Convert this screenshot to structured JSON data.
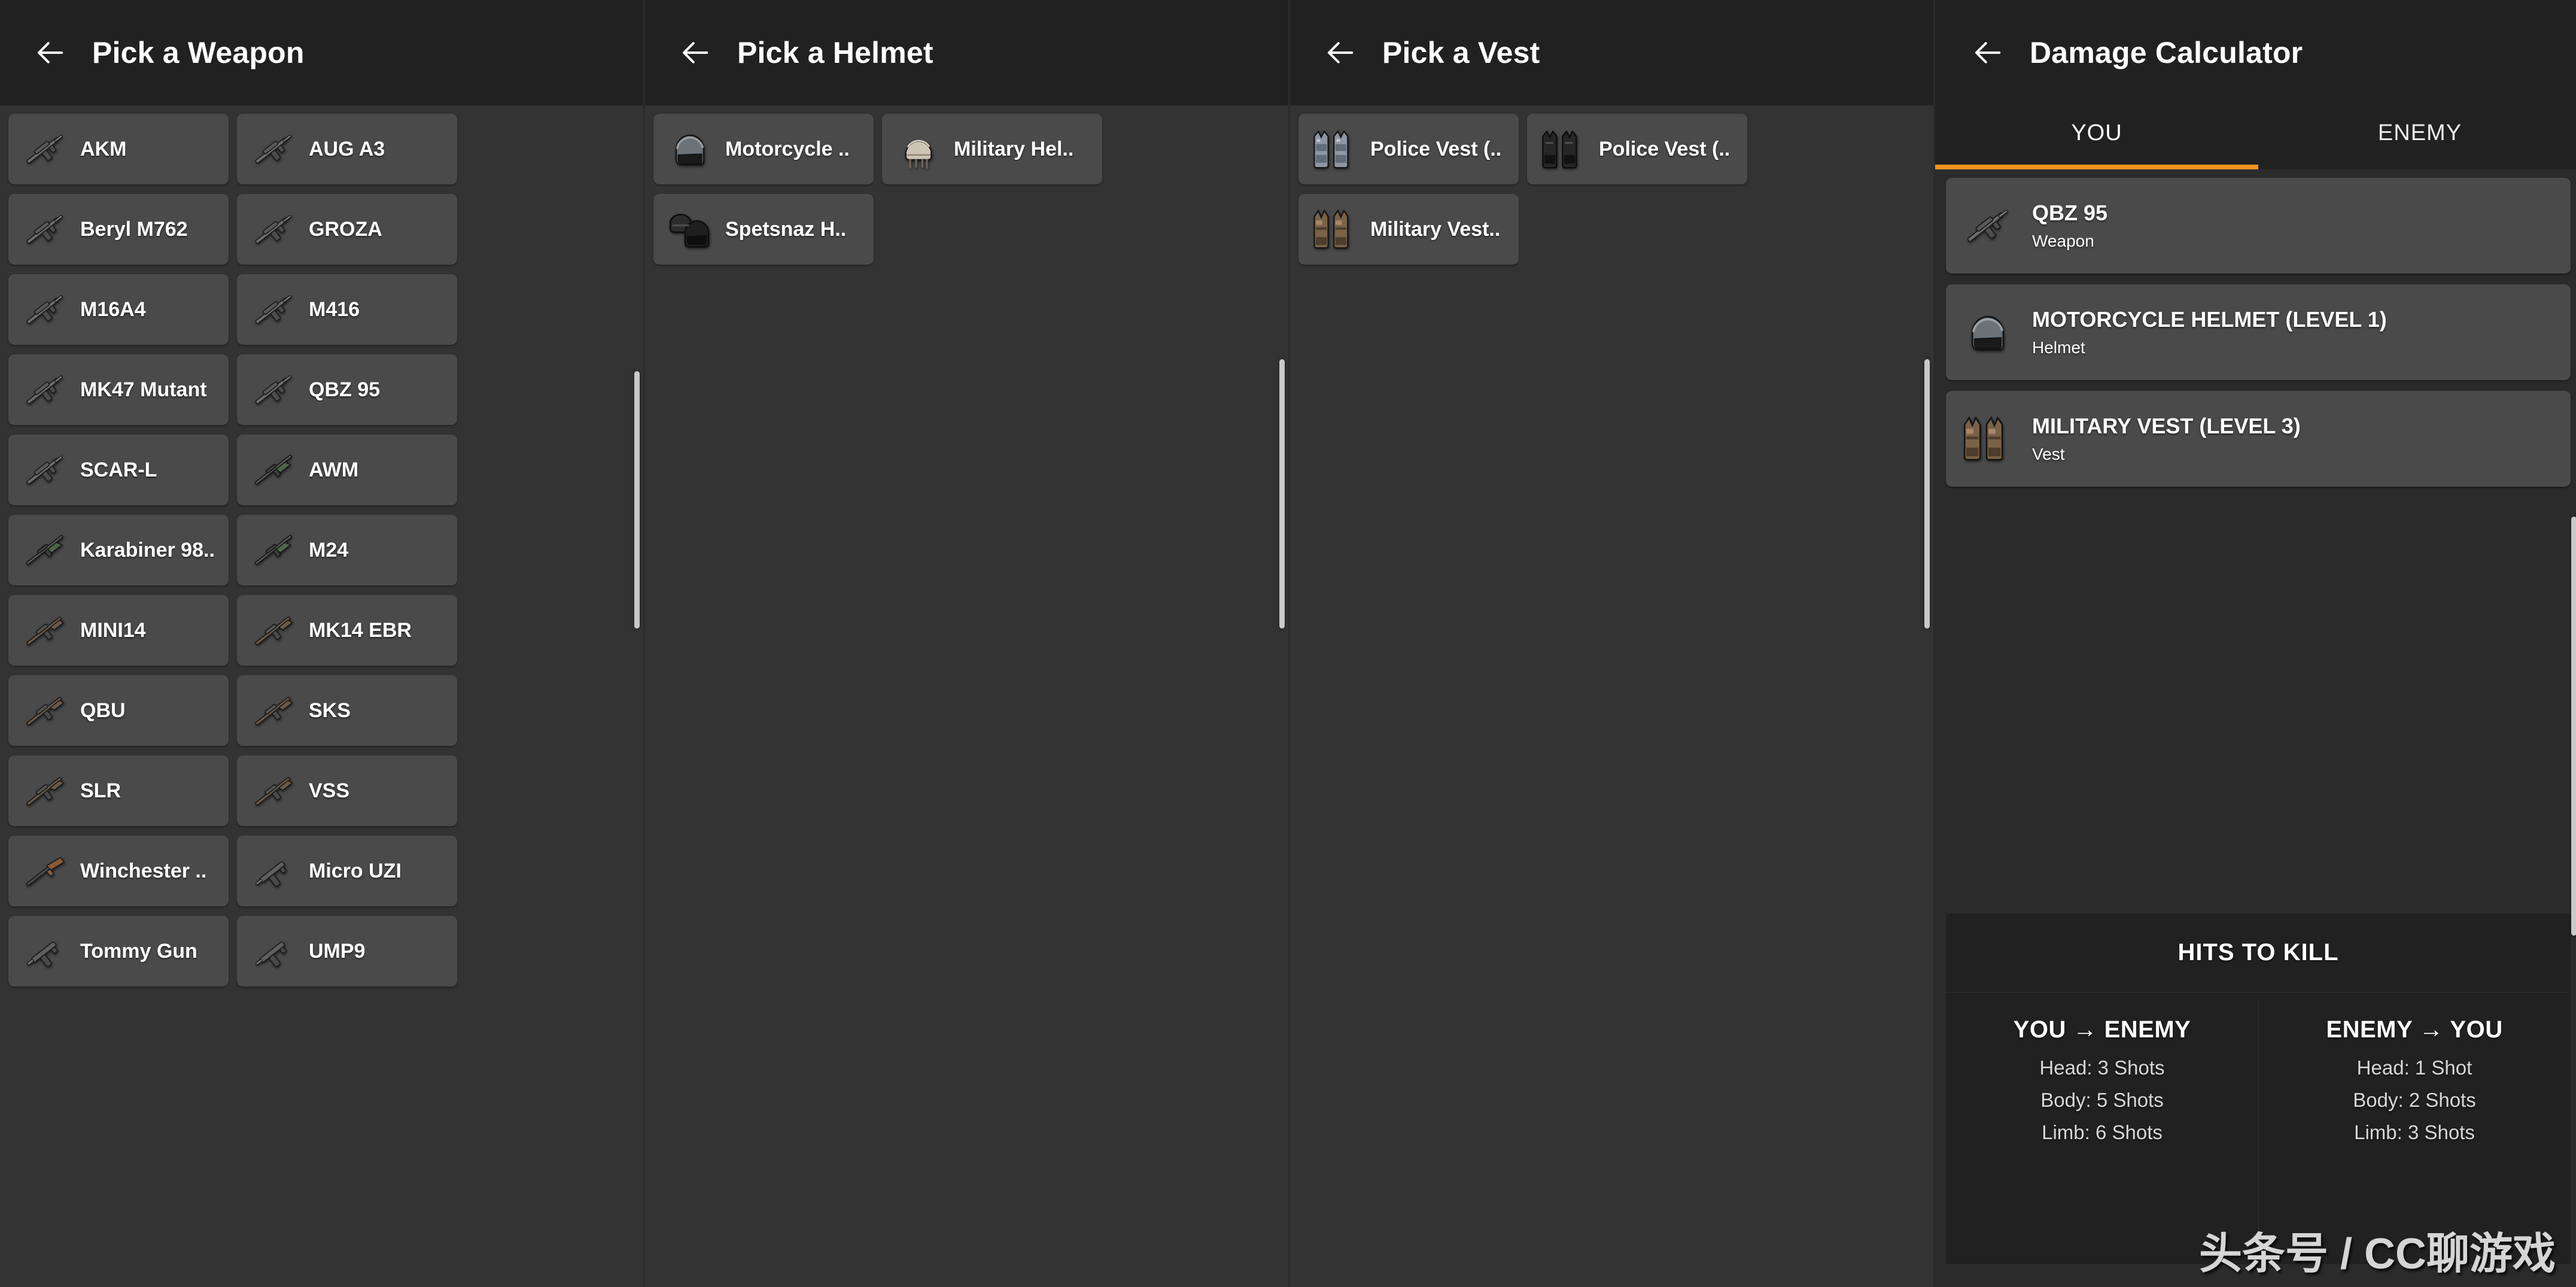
{
  "columns": {
    "weapon": {
      "title": "Pick a Weapon",
      "back_icon": "back-arrow-icon",
      "items": [
        {
          "label": "AKM",
          "icon": "rifle-icon"
        },
        {
          "label": "AUG A3",
          "icon": "rifle-icon"
        },
        {
          "label": "Beryl M762",
          "icon": "rifle-icon"
        },
        {
          "label": "GROZA",
          "icon": "rifle-icon"
        },
        {
          "label": "M16A4",
          "icon": "rifle-icon"
        },
        {
          "label": "M416",
          "icon": "rifle-icon"
        },
        {
          "label": "MK47 Mutant",
          "icon": "rifle-icon"
        },
        {
          "label": "QBZ 95",
          "icon": "rifle-icon"
        },
        {
          "label": "SCAR-L",
          "icon": "rifle-icon"
        },
        {
          "label": "AWM",
          "icon": "sniper-icon"
        },
        {
          "label": "Karabiner 98..",
          "icon": "sniper-icon"
        },
        {
          "label": "M24",
          "icon": "sniper-icon"
        },
        {
          "label": "MINI14",
          "icon": "dmr-icon"
        },
        {
          "label": "MK14 EBR",
          "icon": "dmr-icon"
        },
        {
          "label": "QBU",
          "icon": "dmr-icon"
        },
        {
          "label": "SKS",
          "icon": "dmr-icon"
        },
        {
          "label": "SLR",
          "icon": "dmr-icon"
        },
        {
          "label": "VSS",
          "icon": "dmr-icon"
        },
        {
          "label": "Winchester ..",
          "icon": "shotgun-icon"
        },
        {
          "label": "Micro UZI",
          "icon": "smg-icon"
        },
        {
          "label": "Tommy Gun",
          "icon": "smg-icon"
        },
        {
          "label": "UMP9",
          "icon": "smg-icon"
        }
      ]
    },
    "helmet": {
      "title": "Pick a Helmet",
      "back_icon": "back-arrow-icon",
      "items": [
        {
          "label": "Motorcycle ..",
          "icon": "motorcycle-helmet-icon"
        },
        {
          "label": "Military Hel..",
          "icon": "military-helmet-icon"
        },
        {
          "label": "Spetsnaz H..",
          "icon": "spetsnaz-helmet-icon"
        }
      ]
    },
    "vest": {
      "title": "Pick a Vest",
      "back_icon": "back-arrow-icon",
      "items": [
        {
          "label": "Police Vest (..",
          "icon": "police-vest-icon"
        },
        {
          "label": "Police Vest (..",
          "icon": "police-vest-dark-icon"
        },
        {
          "label": "Military Vest..",
          "icon": "military-vest-icon"
        }
      ]
    },
    "calculator": {
      "title": "Damage Calculator",
      "back_icon": "back-arrow-icon",
      "tabs": [
        {
          "label": "YOU",
          "active": true
        },
        {
          "label": "ENEMY",
          "active": false
        }
      ],
      "accent_color": "#f5921f",
      "equipment": [
        {
          "name": "QBZ 95",
          "kind": "Weapon",
          "icon": "rifle-icon"
        },
        {
          "name": "MOTORCYCLE HELMET (LEVEL 1)",
          "kind": "Helmet",
          "icon": "motorcycle-helmet-icon"
        },
        {
          "name": "MILITARY VEST (LEVEL 3)",
          "kind": "Vest",
          "icon": "military-vest-icon"
        }
      ],
      "hits_to_kill": {
        "title": "HITS TO KILL",
        "left": {
          "heading": "YOU → ENEMY",
          "lines": [
            "Head: 3 Shots",
            "Body: 5 Shots",
            "Limb: 6 Shots"
          ]
        },
        "right": {
          "heading": "ENEMY → YOU",
          "lines": [
            "Head: 1 Shot",
            "Body: 2 Shots",
            "Limb: 3 Shots"
          ]
        }
      }
    }
  },
  "watermark": "头条号 / CC聊游戏"
}
